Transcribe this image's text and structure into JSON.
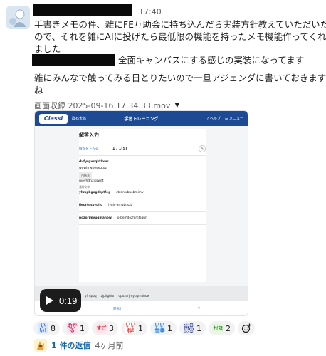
{
  "message": {
    "time": "17:40",
    "lines": [
      "手書きメモの件、雑にFE互助会に持ち込んだら実装方針教えていただいた",
      "ので、それを雑にAIに投げたら最低限の機能を持ったメモ機能作ってくれ",
      "ました",
      "全面キャンバスにする感じの実装になってます",
      "雑にみんなで触ってみる日とりたいので一旦アジェンダに書いておきます",
      "ね"
    ]
  },
  "attachment": {
    "filename": "画面収録 2025-09-16 17.34.33.mov",
    "duration": "0:19",
    "screen": {
      "logo": "Classi",
      "user": "群石太郎",
      "title": "学習トレーニング",
      "help": "? ヘルプ",
      "menu": "☰ メニュー",
      "heading": "解答入力",
      "back_link": "解答を下ろる",
      "page": "1 / 1(5)",
      "rows": [
        {
          "type": "bold",
          "text": "dvfyrgvsqktlowr"
        },
        {
          "type": "plain",
          "text": "wowjfrwbesxqtozi"
        },
        {
          "type": "chip",
          "text": "白帳法"
        },
        {
          "type": "plain",
          "text": "ujoyhdnzjsswjft"
        },
        {
          "type": "small",
          "text": "通常文字"
        }
      ],
      "pairs": [
        [
          "yhmpbgogdzptfeg",
          "ctzenlxbuobmimv"
        ],
        [
          "jjeurtdssyujju",
          "jyulx-amqbdszb"
        ],
        [
          "pozorjmyuqmahow",
          "o-bemdozfomtsgun"
        ]
      ],
      "strip_items": [
        "yfrnpbq",
        "zjplfgbto",
        "upozorjmyuqmahow"
      ],
      "prev": "前返し",
      "next": ">"
    }
  },
  "reactions": [
    {
      "label": "いい!",
      "count": "8",
      "bg": "#d8e6ff",
      "fg": "#3466cc"
    },
    {
      "label": "助かる",
      "count": "1",
      "bg": "#ffe1ea",
      "fg": "#d0336a"
    },
    {
      "label": "すご",
      "count": "3",
      "bg": "#ffe3e8",
      "fg": "#e0364d"
    },
    {
      "label": "いいね!",
      "count": "1",
      "bg": "#ffffff",
      "fg": "#e03b3b"
    },
    {
      "label": "いい仕事",
      "count": "1",
      "bg": "#dff0ff",
      "fg": "#1f6fd0"
    },
    {
      "label": "神回最高",
      "count": "1",
      "bg": "#1b2f8a",
      "fg": "#ffffff"
    },
    {
      "label": "ﾅｲｽ!",
      "count": "2",
      "bg": "#e3f8dc",
      "fg": "#2f9a28"
    }
  ],
  "thread": {
    "replies": "1 件の返信",
    "time": "4ヶ月前"
  }
}
